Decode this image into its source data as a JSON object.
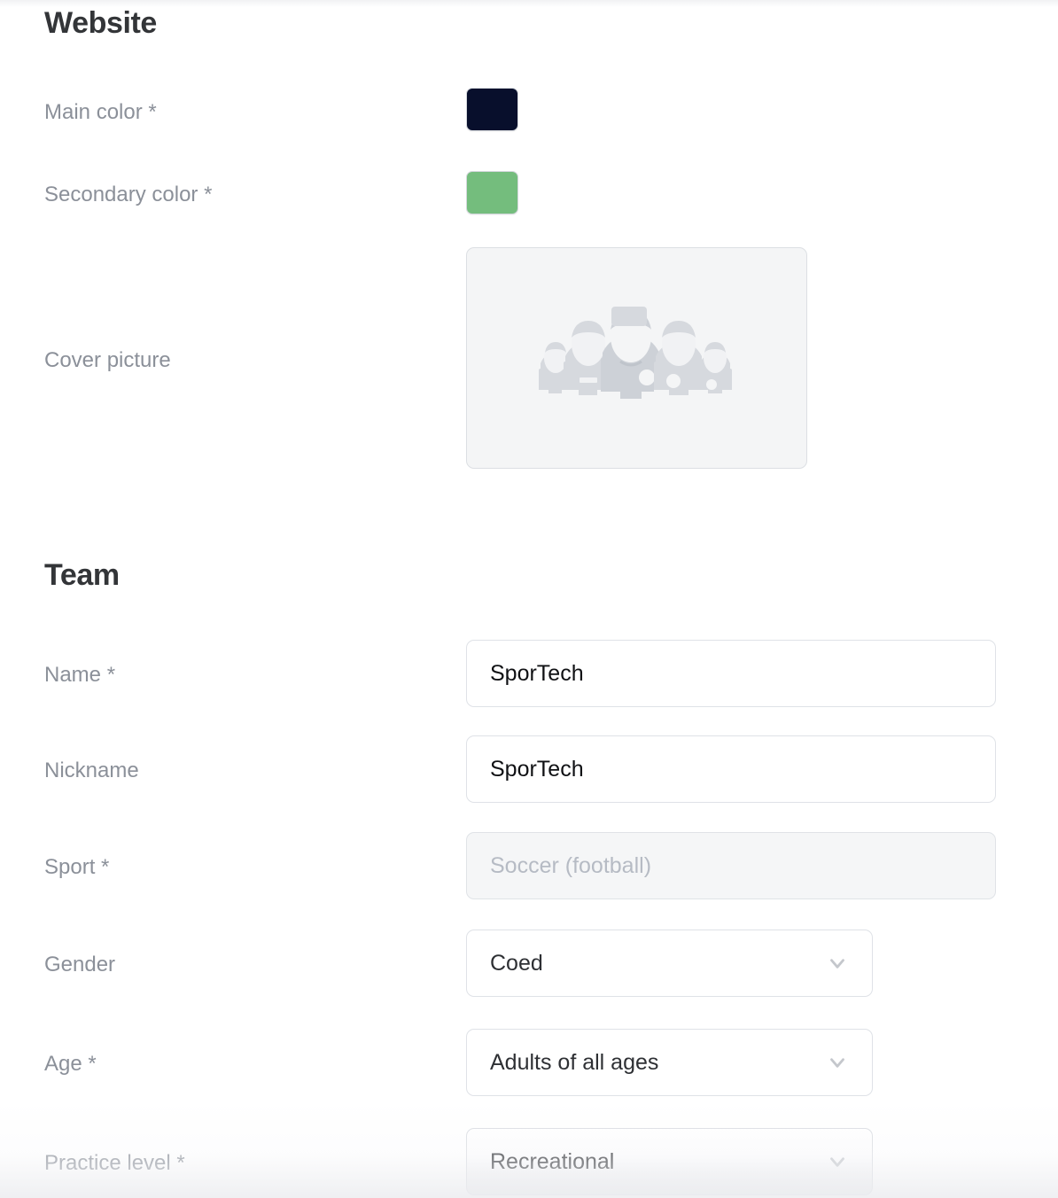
{
  "sections": {
    "website": {
      "title": "Website",
      "fields": {
        "main_color": {
          "label": "Main color *",
          "value": "#080f2c",
          "swatch_name": "main-color-swatch"
        },
        "secondary_color": {
          "label": "Secondary color *",
          "value": "#74bd7d",
          "swatch_name": "secondary-color-swatch"
        },
        "cover_picture": {
          "label": "Cover picture",
          "placeholder_icon": "team-group-placeholder-icon"
        }
      }
    },
    "team": {
      "title": "Team",
      "fields": {
        "name": {
          "label": "Name *",
          "value": "SporTech",
          "placeholder": "",
          "disabled": false
        },
        "nickname": {
          "label": "Nickname",
          "value": "SporTech",
          "placeholder": "",
          "disabled": false
        },
        "sport": {
          "label": "Sport *",
          "value": "Soccer (football)",
          "placeholder": "Soccer (football)",
          "disabled": true
        },
        "gender": {
          "label": "Gender",
          "value": "Coed",
          "chevron_icon": "chevron-down-icon"
        },
        "age": {
          "label": "Age *",
          "value": "Adults of all ages",
          "chevron_icon": "chevron-down-icon"
        },
        "practice_level": {
          "label": "Practice level *",
          "value": "Recreational",
          "chevron_icon": "chevron-down-icon"
        }
      }
    }
  },
  "colors": {
    "main": "#080f2c",
    "secondary": "#74bd7d",
    "label_text": "#8b9099",
    "heading_text": "#333538",
    "input_border": "#dfe2e7",
    "disabled_bg": "#f5f6f7",
    "placeholder_bg": "#f4f5f6"
  }
}
